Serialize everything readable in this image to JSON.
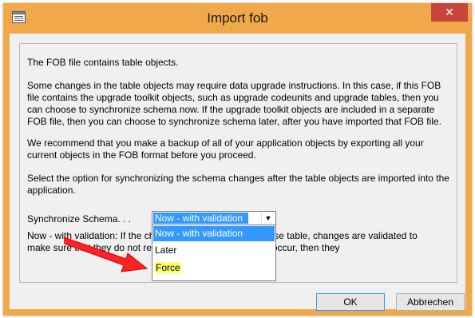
{
  "window": {
    "title": "Import fob",
    "close_label": "✕",
    "colors": {
      "frame": "#f0a848",
      "close": "#c7463b",
      "selection": "#3399ff",
      "highlight": "#ffff66",
      "arrow": "#ff2222"
    }
  },
  "content": {
    "intro": "The FOB file contains table objects.",
    "paragraph2": "Some changes in the table objects may require data upgrade instructions. In this case, if this FOB file contains the upgrade toolkit objects, such as upgrade codeunits and upgrade tables, then you can choose to synchronize schema now. If the upgrade toolkit objects are included in a separate FOB file, then you can choose to synchronize schema later, after you have imported that FOB file.",
    "paragraph3": "We recommend that you make a backup of all of your application objects by exporting all your current objects in the FOB format before you proceed.",
    "paragraph4": "Select the option for synchronizing the schema changes after the table objects are imported into the application.",
    "sync_label": "Synchronize Schema. . .",
    "sync_selected": "Now - with validation",
    "sync_options": [
      "Now - with validation",
      "Later",
      "Force"
    ],
    "hidden_line1": "Now - with validation: If the changes would affect a database table, changes are validated to",
    "hidden_line2": "make sure that they do not result in data loss. If no errors occur, then they"
  },
  "buttons": {
    "ok": "OK",
    "cancel": "Abbrechen"
  }
}
